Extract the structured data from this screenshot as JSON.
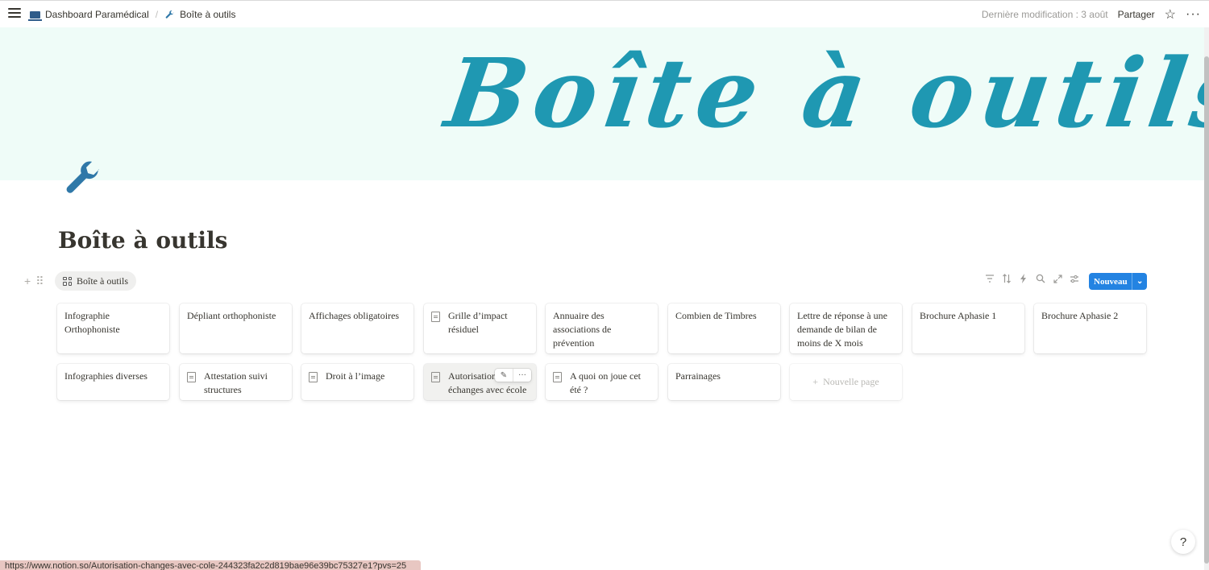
{
  "topbar": {
    "breadcrumbs": [
      {
        "label": "Dashboard Paramédical",
        "icon": "laptop-icon"
      },
      {
        "label": "Boîte à outils",
        "icon": "wrench-icon"
      }
    ],
    "last_modified": "Dernière modification : 3 août",
    "share_label": "Partager",
    "star_icon": "☆",
    "more_icon": "···"
  },
  "cover": {
    "title_art": "Boîte à outils",
    "background": "#effcf8",
    "accent": "#1f98b2"
  },
  "page": {
    "icon": "wrench-icon",
    "icon_color": "#2f78a8",
    "title": "Boîte à outils"
  },
  "view": {
    "tab_label": "Boîte à outils",
    "new_button_label": "Nouveau",
    "new_button_color": "#2383e2",
    "toolbar_icons": [
      "filter-icon",
      "sort-icon",
      "lightning-icon",
      "search-icon",
      "expand-icon",
      "settings-icon"
    ]
  },
  "cards": {
    "row1": [
      {
        "title": "Infographie Orthophoniste",
        "has_doc_icon": false
      },
      {
        "title": "Dépliant orthophoniste",
        "has_doc_icon": false
      },
      {
        "title": "Affichages obligatoires",
        "has_doc_icon": false
      },
      {
        "title": "Grille d’impact résiduel",
        "has_doc_icon": true
      },
      {
        "title": "Annuaire des associations de prévention",
        "has_doc_icon": false
      },
      {
        "title": "Combien de Timbres",
        "has_doc_icon": false
      },
      {
        "title": "Lettre de réponse à une demande de bilan de moins de X mois",
        "has_doc_icon": false
      },
      {
        "title": "Brochure Aphasie 1",
        "has_doc_icon": false
      },
      {
        "title": "Brochure Aphasie 2",
        "has_doc_icon": false
      }
    ],
    "row2": [
      {
        "title": "Infographies diverses",
        "has_doc_icon": false
      },
      {
        "title": "Attestation suivi structures",
        "has_doc_icon": true
      },
      {
        "title": "Droit à l’image",
        "has_doc_icon": true
      },
      {
        "title": "Autorisation échanges avec école",
        "has_doc_icon": true
      },
      {
        "title": "A quoi on joue cet été ?",
        "has_doc_icon": true
      },
      {
        "title": "Parrainages",
        "has_doc_icon": false
      }
    ],
    "new_page_label": "Nouvelle page"
  },
  "status_bar": {
    "url": "https://www.notion.so/Autorisation-changes-avec-cole-244323fa2c2d819bae96e39bc75327e1?pvs=25"
  },
  "help_button": {
    "glyph": "?"
  }
}
